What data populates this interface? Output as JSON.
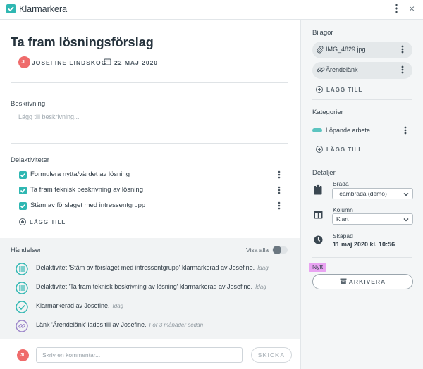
{
  "header": {
    "title": "Klarmarkera",
    "close_glyph": "×"
  },
  "card": {
    "title": "Ta fram lösningsförslag",
    "author_initials": "JL",
    "author_name": "JOSEFINE LINDSKOG",
    "date": "22 MAJ 2020"
  },
  "description": {
    "label": "Beskrivning",
    "placeholder": "Lägg till beskrivning..."
  },
  "subtasks": {
    "label": "Delaktiviteter",
    "items": [
      {
        "label": "Formulera nytta/värdet av lösning",
        "checked": true
      },
      {
        "label": "Ta fram teknisk beskrivning av lösning",
        "checked": true
      },
      {
        "label": "Stäm av förslaget med intressentgrupp",
        "checked": true
      }
    ],
    "add_label": "LÄGG TILL"
  },
  "events": {
    "label": "Händelser",
    "show_all_label": "Visa alla",
    "show_all_on": false,
    "items": [
      {
        "icon": "checklist-icon",
        "text": "Delaktivitet 'Stäm av förslaget med intressentgrupp' klarmarkerad av Josefine.",
        "when": "Idag"
      },
      {
        "icon": "checklist-icon",
        "text": "Delaktivitet 'Ta fram teknisk beskrivning av lösning' klarmarkerad av Josefine.",
        "when": "Idag"
      },
      {
        "icon": "check-circle-icon",
        "text": "Klarmarkerad av Josefine.",
        "when": "Idag"
      },
      {
        "icon": "link-icon",
        "text": "Länk 'Ärendelänk' lades till av Josefine.",
        "when": "För 3 månader sedan"
      }
    ]
  },
  "comment": {
    "avatar_initials": "JL",
    "placeholder": "Skriv en kommentar...",
    "send_label": "SKICKA"
  },
  "attachments": {
    "label": "Bilagor",
    "items": [
      {
        "icon": "paperclip-icon",
        "label": "IMG_4829.jpg"
      },
      {
        "icon": "link-icon",
        "label": "Ärendelänk"
      }
    ],
    "add_label": "LÄGG TILL"
  },
  "categories": {
    "label": "Kategorier",
    "items": [
      {
        "label": "Löpande arbete",
        "color": "#5cc4c0"
      }
    ],
    "add_label": "LÄGG TILL"
  },
  "details": {
    "label": "Detaljer",
    "board_label": "Bräda",
    "board_value": "Teambräda (demo)",
    "column_label": "Kolumn",
    "column_value": "Klart",
    "created_label": "Skapad",
    "created_value": "11 maj 2020 kl. 10:56"
  },
  "tooltip": "Nytt",
  "archive_label": "ARKIVERA",
  "colors": {
    "accent": "#2fb7b2",
    "avatar": "#ef6b6b",
    "tooltip": "#e9a3f2"
  }
}
